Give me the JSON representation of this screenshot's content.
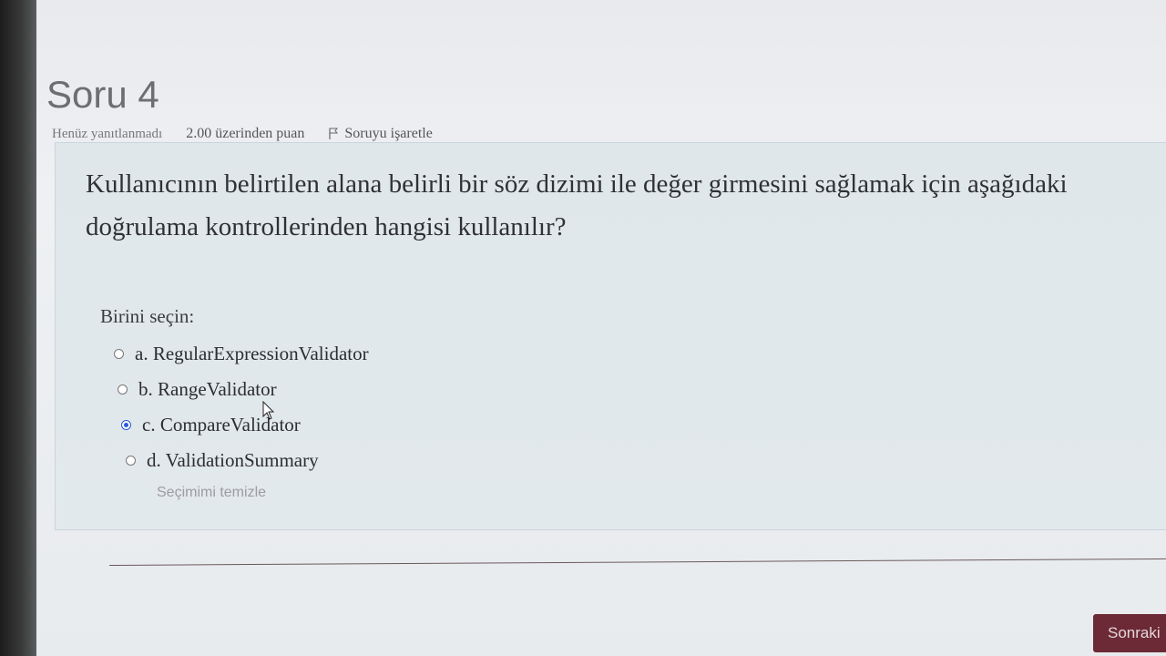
{
  "question": {
    "title": "Soru 4",
    "status": "Henüz yanıtlanmadı",
    "points": "2.00 üzerinden puan",
    "flag_label": "Soruyu işaretle",
    "text": "Kullanıcının belirtilen alana belirli bir söz dizimi ile değer girmesini sağlamak için aşağıdaki doğrulama kontrollerinden hangisi kullanılır?",
    "prompt": "Birini seçin:",
    "answers": [
      {
        "label": "a. RegularExpressionValidator",
        "selected": false
      },
      {
        "label": "b. RangeValidator",
        "selected": false
      },
      {
        "label": "c. CompareValidator",
        "selected": true
      },
      {
        "label": "d. ValidationSummary",
        "selected": false
      }
    ],
    "clear_label": "Seçimimi temizle"
  },
  "navigation": {
    "next_label": "Sonraki"
  },
  "colors": {
    "accent": "#6b2a35",
    "radio_selected": "#2a5bd7"
  }
}
